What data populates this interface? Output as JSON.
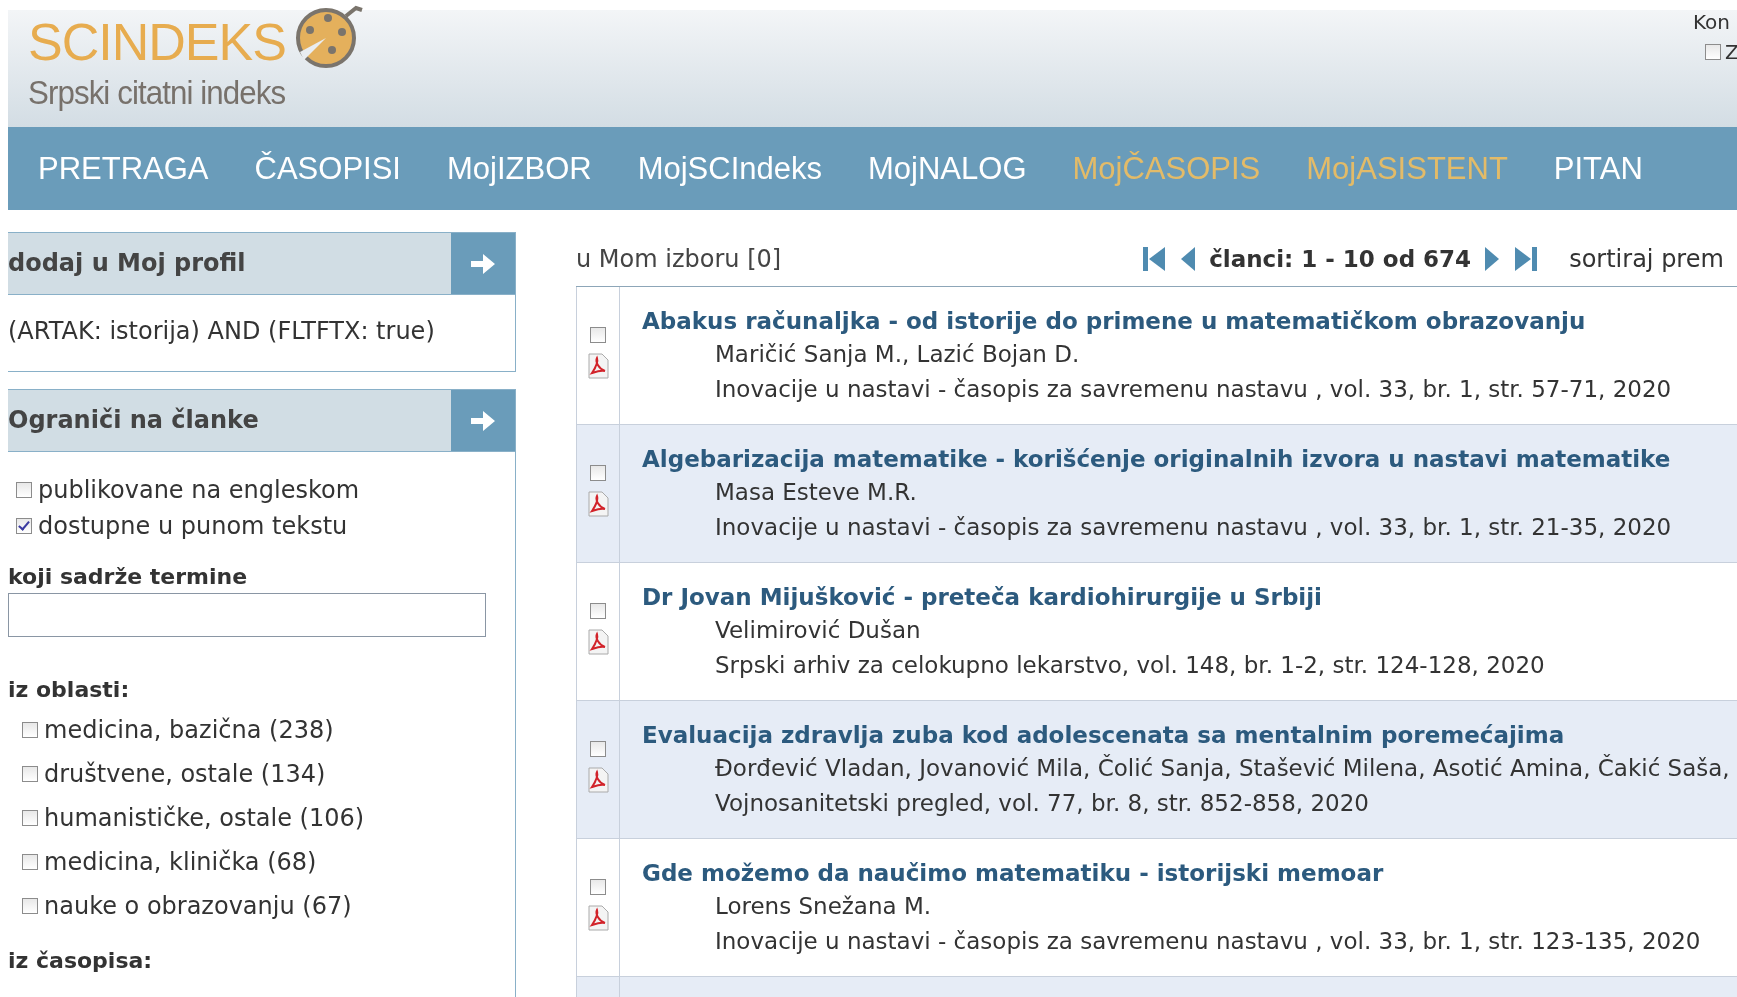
{
  "header": {
    "logo_title": "SCINDEKS",
    "logo_subtitle": "Srpski citatni indeks",
    "corner_text": "Kon",
    "corner_option": {
      "label": "Z",
      "checked": false
    }
  },
  "nav": [
    {
      "label": "PRETRAGA",
      "kind": "normal"
    },
    {
      "label": "ČASOPISI",
      "kind": "normal"
    },
    {
      "label": "MojIZBOR",
      "kind": "normal"
    },
    {
      "label": "MojSCIndeks",
      "kind": "normal"
    },
    {
      "label": "MojNALOG",
      "kind": "normal"
    },
    {
      "label": "MojČASOPIS",
      "kind": "accent"
    },
    {
      "label": "MojASISTENT",
      "kind": "accent"
    },
    {
      "label": "PITAN",
      "kind": "normal"
    }
  ],
  "profile_panel": {
    "title": "dodaj u Moj profil",
    "query": "(ARTAK: istorija) AND (FLTFTX: true)"
  },
  "limit_panel": {
    "title": "Ograniči na članke",
    "options": [
      {
        "label": "publikovane na engleskom",
        "checked": false
      },
      {
        "label": "dostupne u punom tekstu",
        "checked": true
      }
    ],
    "terms_label": "koji sadrže termine",
    "fields_label": "iz oblasti:",
    "fields": [
      {
        "label": "medicina, bazična (238)",
        "checked": false
      },
      {
        "label": "društvene, ostale (134)",
        "checked": false
      },
      {
        "label": "humanističke, ostale (106)",
        "checked": false
      },
      {
        "label": "medicina, klinička (68)",
        "checked": false
      },
      {
        "label": "nauke o obrazovanju (67)",
        "checked": false
      }
    ],
    "journals_label": "iz časopisa:"
  },
  "results": {
    "my_selection": "u Mom izboru [0]",
    "range": "članci: 1 - 10 od 674",
    "sort_label": "sortiraj prem",
    "rows": [
      {
        "title": "Abakus računaljka - od istorije do primene u matematičkom obrazovanju",
        "authors": "Maričić Sanja M., Lazić Bojan D.",
        "source": "Inovacije u nastavi - časopis za savremenu nastavu , vol. 33, br. 1, str. 57-71, 2020",
        "checked": false
      },
      {
        "title": "Algebarizacija matematike - korišćenje originalnih izvora u nastavi matematike",
        "authors": "Masa Esteve M.R.",
        "source": "Inovacije u nastavi - časopis za savremenu nastavu , vol. 33, br. 1, str. 21-35, 2020",
        "checked": false
      },
      {
        "title": "Dr Jovan Mijušković - preteča kardiohirurgije u Srbiji",
        "authors": "Velimirović Dušan",
        "source": "Srpski arhiv za celokupno lekarstvo, vol. 148, br. 1-2, str. 124-128, 2020",
        "checked": false
      },
      {
        "title": "Evaluacija zdravlja zuba kod adolescenata sa mentalnim poremećajima",
        "authors": "Đorđević Vladan, Jovanović Mila, Čolić Sanja, Stašević Milena, Asotić Amina, Čakić Saša,",
        "source": "Vojnosanitetski pregled, vol. 77, br. 8, str. 852-858, 2020",
        "checked": false
      },
      {
        "title": "Gde možemo da naučimo matematiku - istorijski memoar",
        "authors": "Lorens Snežana M.",
        "source": "Inovacije u nastavi - časopis za savremenu nastavu , vol. 33, br. 1, str. 123-135, 2020",
        "checked": false
      }
    ]
  }
}
